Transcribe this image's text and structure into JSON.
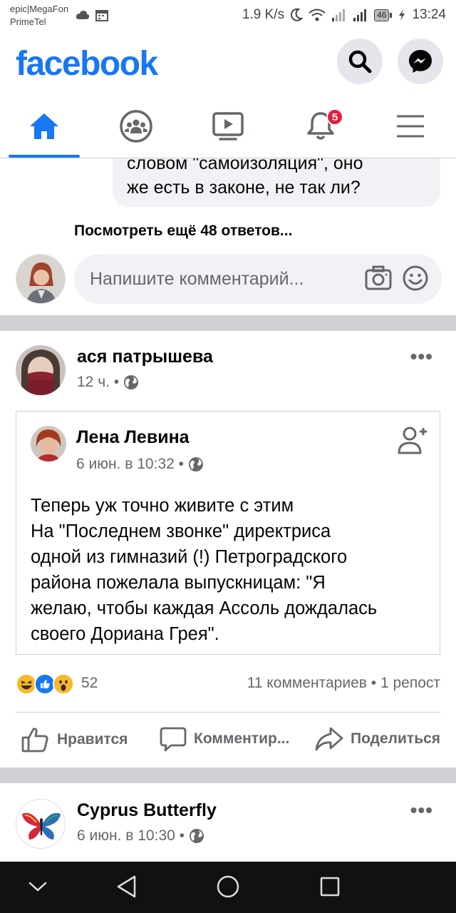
{
  "status_bar": {
    "carrier_line1": "epic|MegaFon",
    "carrier_line2": "PrimeTel",
    "speed": "1.9 K/s",
    "battery": "46",
    "time": "13:24"
  },
  "header": {
    "logo": "facebook",
    "brand_color": "#1877f2"
  },
  "tabs": [
    {
      "name": "home",
      "icon": "home-icon",
      "active": true
    },
    {
      "name": "groups",
      "icon": "groups-icon"
    },
    {
      "name": "watch",
      "icon": "video-icon"
    },
    {
      "name": "notifications",
      "icon": "bell-icon",
      "badge": "5"
    },
    {
      "name": "menu",
      "icon": "menu-icon"
    }
  ],
  "comment_snippet": {
    "line1": "словом \"самоизоляция\", оно",
    "line2": "же есть в законе, не так ли?"
  },
  "view_more_replies": "Посмотреть ещё 48 ответов...",
  "comment_input": {
    "placeholder": "Напишите комментарий..."
  },
  "post1": {
    "author": "ася патрышева",
    "time": "12 ч. •",
    "more": "•••",
    "shared": {
      "author": "Лена Левина",
      "time": "6 июн. в 10:32 •",
      "text_lines": [
        "Теперь уж точно живите с этим",
        "На \"Последнем звонке\" директриса",
        "одной из гимназий (!) Петроградского",
        "района пожелала выпускницам: \"Я",
        "желаю, чтобы каждая Ассоль дождалась",
        "своего Дориана Грея\"."
      ]
    },
    "reactions_count": "52",
    "comments_shares": "11 комментариев • 1 репост",
    "actions": {
      "like": "Нравится",
      "comment": "Комментир...",
      "share": "Поделиться"
    }
  },
  "post2": {
    "author": "Cyprus Butterfly",
    "time": "6 июн. в 10:30 •",
    "more": "•••"
  }
}
